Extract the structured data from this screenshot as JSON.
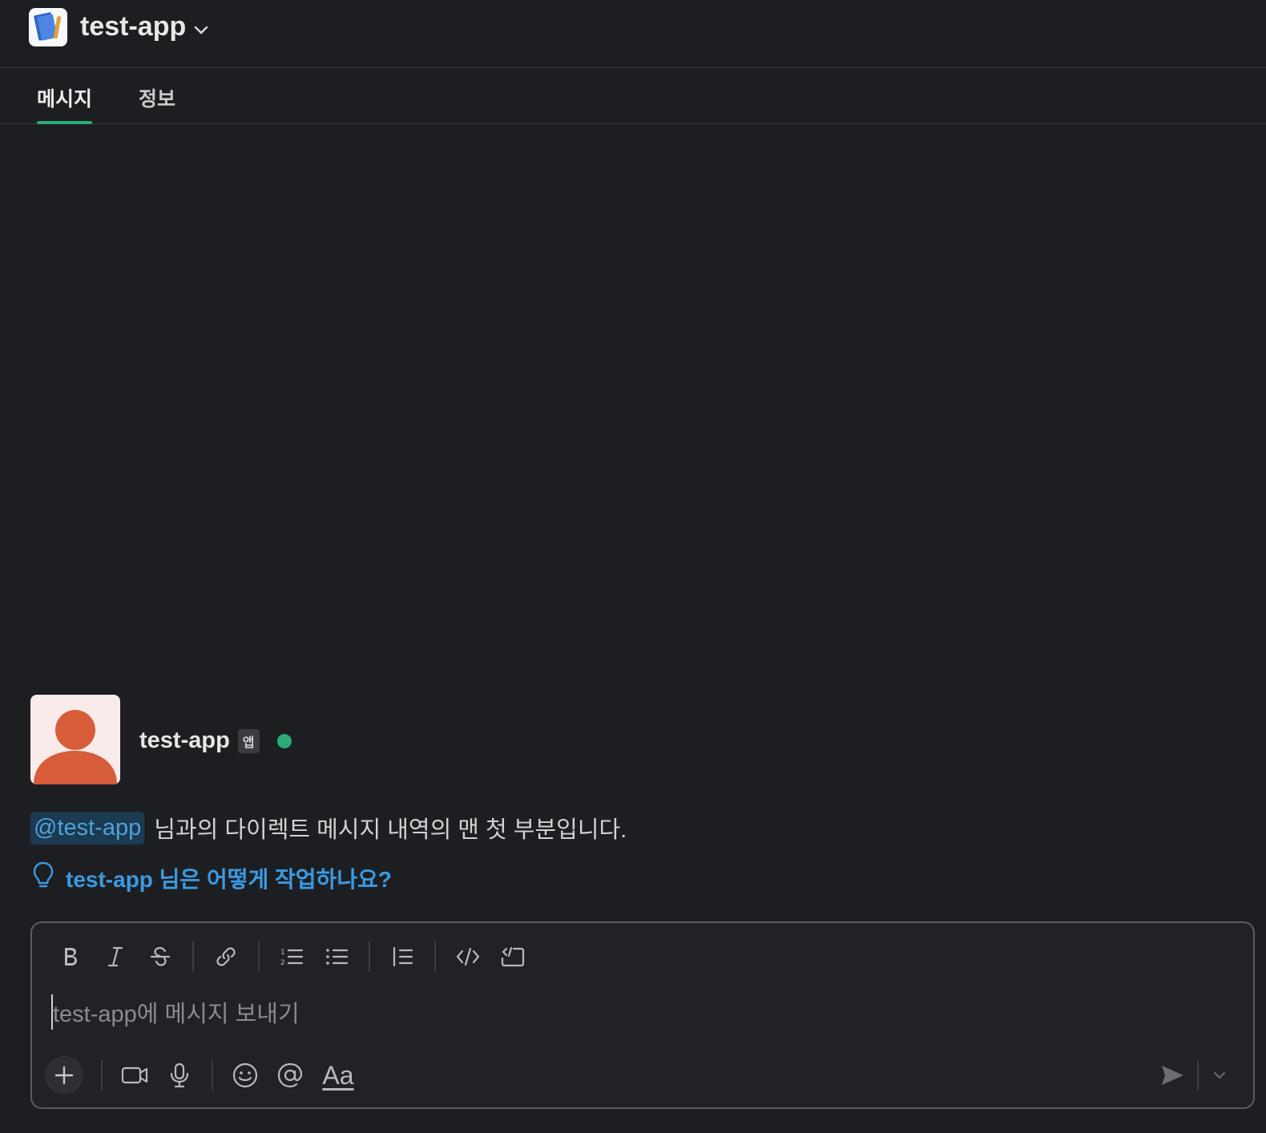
{
  "header": {
    "app_name": "test-app"
  },
  "tabs": [
    {
      "label": "메시지",
      "active": true
    },
    {
      "label": "정보",
      "active": false
    }
  ],
  "profile": {
    "name": "test-app",
    "badge": "앱",
    "status": "online"
  },
  "intro": {
    "mention": "@test-app",
    "text": "님과의 다이렉트 메시지 내역의 맨 첫 부분입니다."
  },
  "howto": {
    "label": "test-app 님은 어떻게 작업하나요?"
  },
  "composer": {
    "placeholder": "test-app에 메시지 보내기",
    "format_toolbar": [
      "bold",
      "italic",
      "strikethrough",
      "link",
      "ordered-list",
      "bulleted-list",
      "blockquote",
      "code",
      "code-block"
    ],
    "bottom_toolbar": [
      "plus",
      "video",
      "microphone",
      "emoji",
      "mention",
      "formatting"
    ],
    "formatting_label": "Aa"
  },
  "colors": {
    "background": "#1d1e22",
    "accent_green": "#2bac76",
    "link_blue": "#3b9ae0",
    "avatar_orange": "#d65c3a"
  }
}
